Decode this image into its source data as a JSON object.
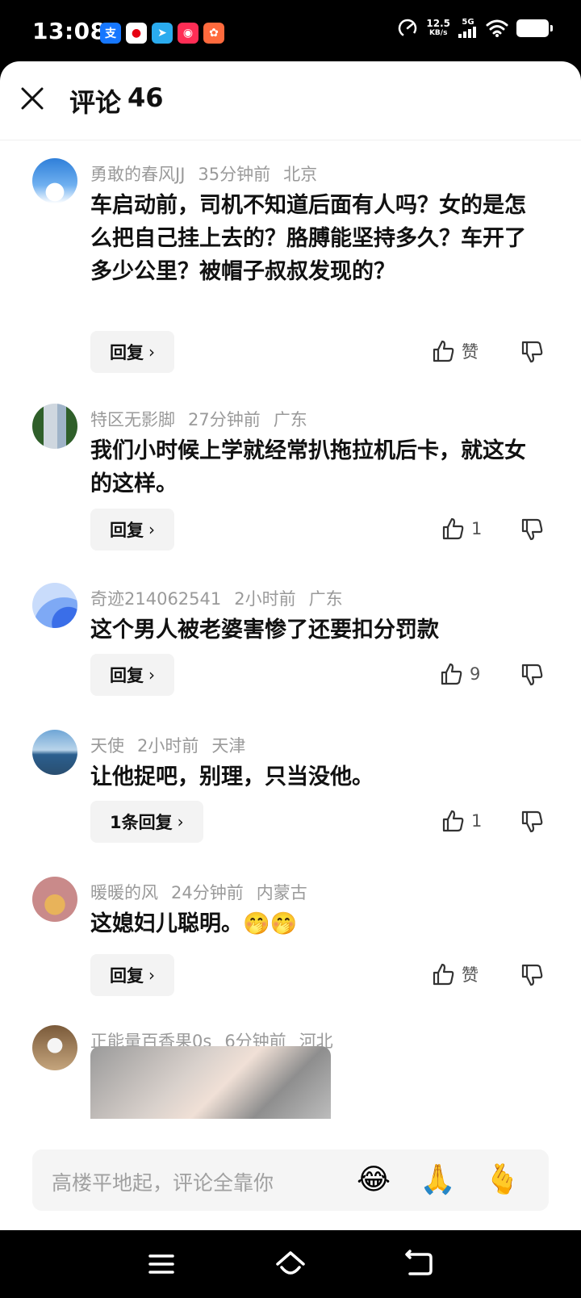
{
  "status": {
    "time": "13:08",
    "speed_value": "12.5",
    "speed_unit": "KB/s",
    "network": "5G",
    "app_icons": [
      "alipay-icon",
      "video-app-icon",
      "telegram-icon",
      "shopping-app-icon",
      "game-app-icon"
    ]
  },
  "header": {
    "title": "评论",
    "count": "46"
  },
  "comments": [
    {
      "user": "勇敢的春风JJ",
      "time": "35分钟前",
      "location": "北京",
      "text": "车启动前，司机不知道后面有人吗？女的是怎么把自己挂上去的？胳膊能坚持多久？车开了多少公里？被帽子叔叔发现的？",
      "reply_label": "回复",
      "like": "赞",
      "avatar": "sky-avatar"
    },
    {
      "user": "特区无影脚",
      "time": "27分钟前",
      "location": "广东",
      "text": "我们小时候上学就经常扒拖拉机后卡，就这女的这样。",
      "reply_label": "回复",
      "like": "1",
      "avatar": "building-avatar"
    },
    {
      "user": "奇迹214062541",
      "time": "2小时前",
      "location": "广东",
      "text": "这个男人被老婆害惨了还要扣分罚款",
      "reply_label": "回复",
      "like": "9",
      "avatar": "blue-wave-avatar"
    },
    {
      "user": "天使",
      "time": "2小时前",
      "location": "天津",
      "text": "让他捉吧，别理，只当没他。",
      "reply_label": "1条回复",
      "like": "1",
      "avatar": "city-avatar"
    },
    {
      "user": "暖暖的风",
      "time": "24分钟前",
      "location": "内蒙古",
      "text": "这媳妇儿聪明。🤭🤭",
      "reply_label": "回复",
      "like": "赞",
      "avatar": "cartoon-avatar"
    },
    {
      "user": "正能量百香果0s",
      "time": "6分钟前",
      "location": "河北",
      "avatar": "badminton-avatar"
    }
  ],
  "input": {
    "placeholder": "高楼平地起，评论全靠你",
    "emojis": [
      "😂",
      "🙏",
      "🫰"
    ]
  }
}
